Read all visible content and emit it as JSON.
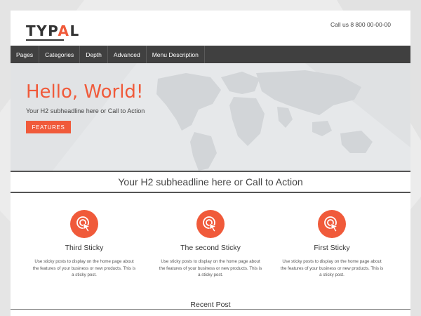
{
  "header": {
    "logo_prefix": "TYP",
    "logo_accent": "A",
    "logo_suffix": "L",
    "call_text": "Call us 8 800 00-00-00"
  },
  "nav": {
    "items": [
      "Pages",
      "Categories",
      "Depth",
      "Advanced",
      "Menu Description"
    ]
  },
  "hero": {
    "title": "Hello, World!",
    "subtitle": "Your H2 subheadline here or Call to Action",
    "button_label": "FEATURES"
  },
  "band": {
    "text": "Your H2 subheadline here or Call to Action"
  },
  "features": [
    {
      "title": "Third Sticky",
      "text": "Use sticky posts to display on the home page about the features of your business or new products. This is a sticky post.",
      "icon": "cursor-click-icon"
    },
    {
      "title": "The second Sticky",
      "text": "Use sticky posts to display on the home page about the features of your business or new products. This is a sticky post.",
      "icon": "cursor-click-icon"
    },
    {
      "title": "First Sticky",
      "text": "Use sticky posts to display on the home page about the features of your business or new products. This is a sticky post.",
      "icon": "cursor-click-icon"
    }
  ],
  "recent": {
    "title": "Recent Post"
  },
  "colors": {
    "accent": "#f05a3a",
    "nav_bg": "#404040",
    "page_bg": "#ececec"
  }
}
